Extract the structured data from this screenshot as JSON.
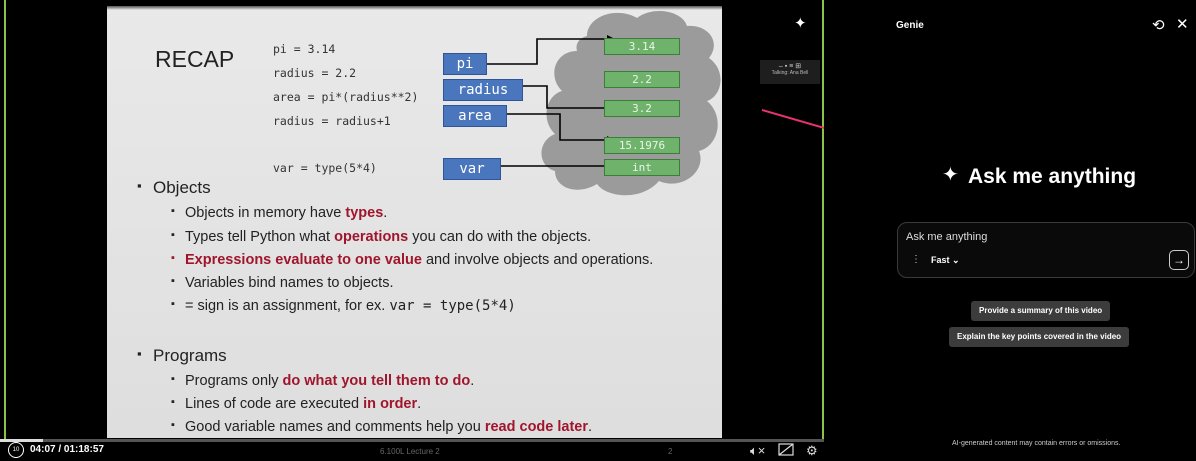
{
  "slide": {
    "title": "RECAP",
    "code": [
      "pi = 3.14",
      "radius = 2.2",
      "area = pi*(radius**2)",
      "radius = radius+1",
      "var = type(5*4)"
    ],
    "vars": [
      "pi",
      "radius",
      "area",
      "var"
    ],
    "values": [
      "3.14",
      "2.2",
      "3.2",
      "15.1976",
      "int"
    ],
    "objects_heading": "Objects",
    "obj1_pre": "Objects in memory have ",
    "obj1_hl": "types",
    "obj1_post": ".",
    "obj2_pre": "Types tell Python what ",
    "obj2_hl": "operations",
    "obj2_post": " you can do with the objects.",
    "obj3_hl": "Expressions evaluate to one value",
    "obj3_post": " and involve objects and operations.",
    "obj4": "Variables bind names to objects.",
    "obj5_pre": "= sign is an assignment, for ex. ",
    "obj5_code": "var = type(5*4)",
    "programs_heading": "Programs",
    "prog1_pre": "Programs only ",
    "prog1_hl": "do what you tell them to do",
    "prog1_post": ".",
    "prog2_pre": "Lines of code are executed ",
    "prog2_hl": "in order",
    "prog2_post": ".",
    "prog3_pre": "Good variable names and comments help you ",
    "prog3_hl": "read code later",
    "prog3_post": "."
  },
  "video": {
    "thumb_label": "Talking: Ana Bell",
    "time": "04:07 / 01:18:57",
    "replay_label": "10",
    "lecture_label": "6.100L Lecture 2",
    "page_num": "2",
    "progress_fraction": 0.052,
    "icons": [
      "sparkle-icon",
      "search-icon",
      "flag-icon",
      "mute-icon",
      "captions-off-icon",
      "settings-icon",
      "pip-icon",
      "fullscreen-icon"
    ]
  },
  "genie": {
    "title": "Genie",
    "heading": "Ask me anything",
    "input_placeholder": "Ask me anything",
    "mode": "Fast",
    "suggestions": [
      "Provide a summary of this video",
      "Explain the key points covered in the video"
    ],
    "disclaimer": "AI-generated content may contain errors or omissions."
  },
  "colors": {
    "accent_arrow": "#e8336d",
    "green_border": "#8bc34a",
    "slide_red": "#a0152c",
    "var_blue": "#4a76bd",
    "val_green": "#6fb26b"
  }
}
